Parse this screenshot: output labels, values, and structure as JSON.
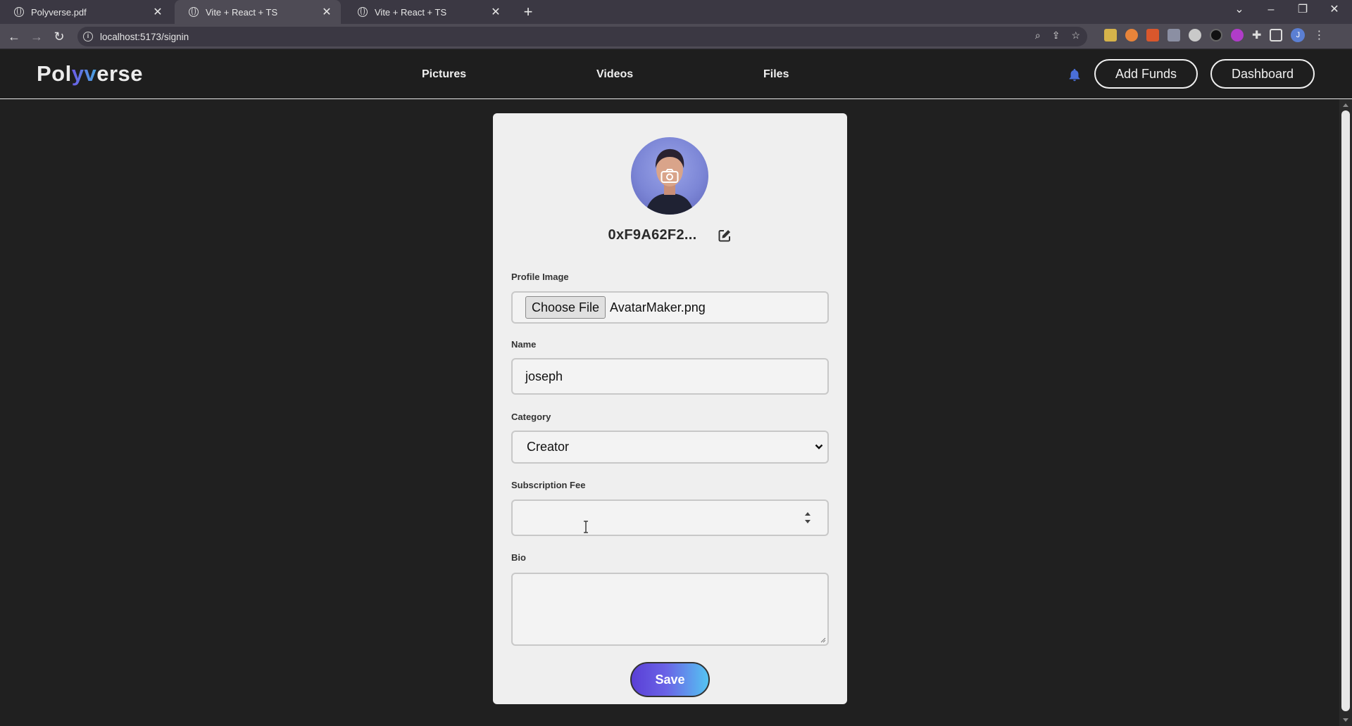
{
  "browser": {
    "tabs": [
      {
        "title": "Polyverse.pdf",
        "active": false
      },
      {
        "title": "Vite + React + TS",
        "active": true
      },
      {
        "title": "Vite + React + TS",
        "active": false
      }
    ],
    "url": "localhost:5173/signin",
    "profile_initial": "J"
  },
  "header": {
    "logo": {
      "part1": "Pol",
      "part2": "yv",
      "part3": "erse"
    },
    "nav": [
      "Pictures",
      "Videos",
      "Files"
    ],
    "add_funds": "Add Funds",
    "dashboard": "Dashboard"
  },
  "profile": {
    "address": "0xF9A62F2...",
    "image_label": "Profile Image",
    "choose_file": "Choose File",
    "file_name": "AvatarMaker.png",
    "name_label": "Name",
    "name_value": "joseph",
    "category_label": "Category",
    "category_value": "Creator",
    "fee_label": "Subscription Fee",
    "fee_value": "",
    "bio_label": "Bio",
    "bio_value": "",
    "save": "Save"
  },
  "colors": {
    "accent_start": "#5a3fd6",
    "accent_end": "#55c4f2",
    "bell": "#4a6fd8",
    "page_bg": "#202020",
    "card_bg": "#efefef"
  }
}
